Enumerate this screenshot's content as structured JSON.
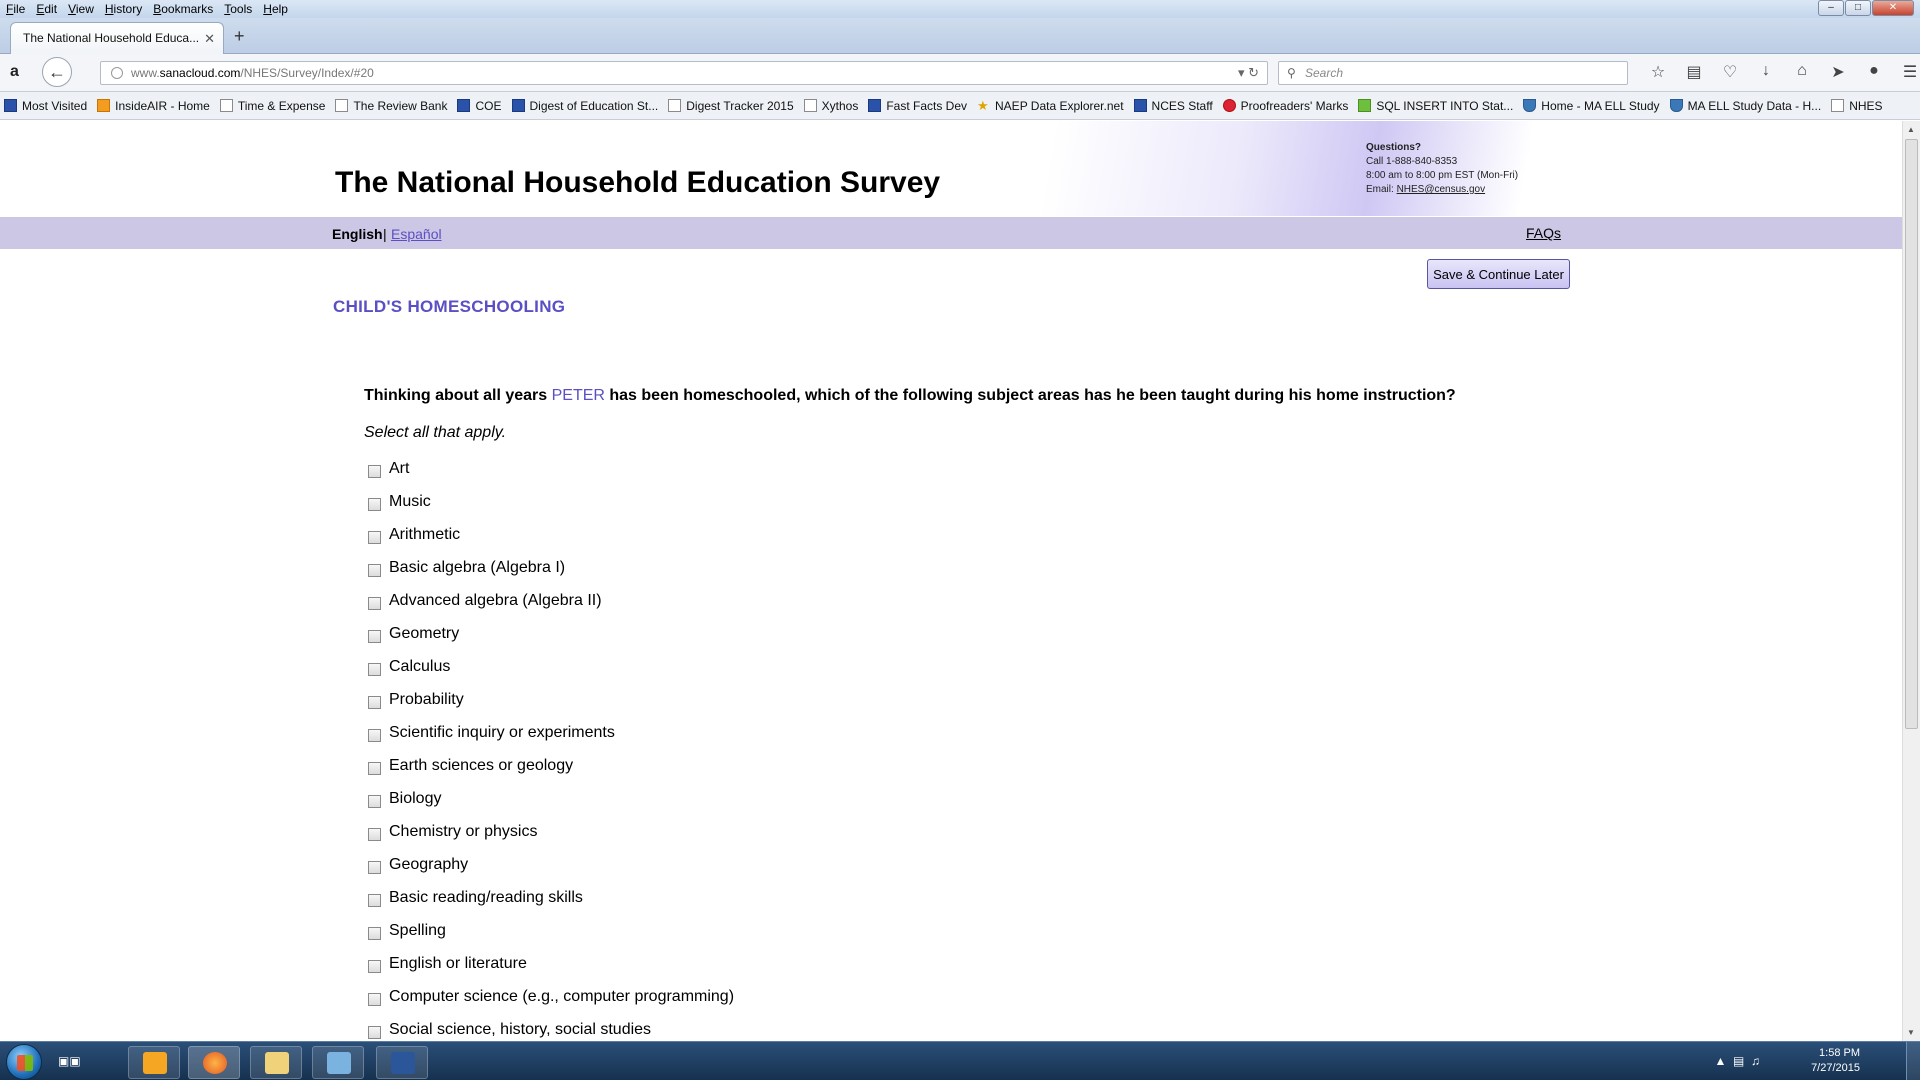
{
  "browser": {
    "menu": [
      "File",
      "Edit",
      "View",
      "History",
      "Bookmarks",
      "Tools",
      "Help"
    ],
    "tab_title": "The National Household Educa...",
    "url_prefix": "www.",
    "url_host": "sanacloud.com",
    "url_path": "/NHES/Survey/Index/#20",
    "search_placeholder": "Search",
    "bookmarks": [
      {
        "label": "Most Visited",
        "icon": "bookmark-blue"
      },
      {
        "label": "InsideAIR - Home",
        "icon": "orange"
      },
      {
        "label": "Time & Expense",
        "icon": "page"
      },
      {
        "label": "The Review Bank",
        "icon": "page"
      },
      {
        "label": "COE",
        "icon": "nces-blue"
      },
      {
        "label": "Digest of Education St...",
        "icon": "nces-blue"
      },
      {
        "label": "Digest Tracker 2015",
        "icon": "page"
      },
      {
        "label": "Xythos",
        "icon": "page"
      },
      {
        "label": "Fast Facts Dev",
        "icon": "nces-blue"
      },
      {
        "label": "NAEP Data Explorer.net",
        "icon": "star"
      },
      {
        "label": "NCES Staff",
        "icon": "nces-blue"
      },
      {
        "label": "Proofreaders' Marks",
        "icon": "round"
      },
      {
        "label": "SQL INSERT INTO Stat...",
        "icon": "green"
      },
      {
        "label": "Home - MA ELL Study",
        "icon": "shield"
      },
      {
        "label": "MA ELL Study Data - H...",
        "icon": "shield"
      },
      {
        "label": "NHES",
        "icon": "page"
      }
    ]
  },
  "site": {
    "title": "The National Household Education Survey",
    "contact": {
      "questions": "Questions?",
      "phone": "Call 1-888-840-8353",
      "hours": "8:00 am to 8:00 pm EST (Mon-Fri)",
      "email_label": "Email: ",
      "email": "NHES@census.gov"
    },
    "lang_english": "English",
    "lang_sep": "|",
    "lang_spanish": "Español",
    "faqs": "FAQs",
    "save_label": "Save & Continue Later"
  },
  "survey": {
    "section": "CHILD'S HOMESCHOOLING",
    "question_before": "Thinking about all years ",
    "child_name": "PETER",
    "question_after": " has been homeschooled, which of the following subject areas has he been taught during his home instruction?",
    "instruction": "Select all that apply.",
    "options": [
      "Art",
      "Music",
      "Arithmetic",
      "Basic algebra (Algebra I)",
      "Advanced algebra (Algebra II)",
      "Geometry",
      "Calculus",
      "Probability",
      "Scientific inquiry or experiments",
      "Earth sciences or geology",
      "Biology",
      "Chemistry or physics",
      "Geography",
      "Basic reading/reading skills",
      "Spelling",
      "English or literature",
      "Computer science (e.g., computer programming)",
      "Social science, history, social studies"
    ]
  },
  "taskbar": {
    "time": "1:58 PM",
    "date": "7/27/2015"
  }
}
